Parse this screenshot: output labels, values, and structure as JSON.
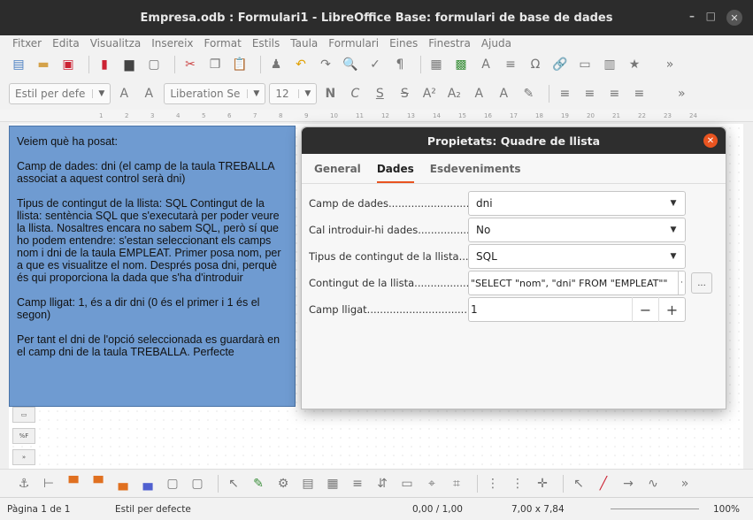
{
  "window": {
    "title": "Empresa.odb : Formulari1 - LibreOffice Base: formulari de base de dades"
  },
  "menu": [
    "Fitxer",
    "Edita",
    "Visualitza",
    "Insereix",
    "Format",
    "Estils",
    "Taula",
    "Formulari",
    "Eines",
    "Finestra",
    "Ajuda"
  ],
  "formatting": {
    "style_value": "Estil per defe",
    "font_value": "Liberation Se",
    "size_value": "12"
  },
  "ruler": [
    "1",
    "2",
    "3",
    "4",
    "5",
    "6",
    "7",
    "8",
    "9",
    "10",
    "11",
    "12",
    "13",
    "14",
    "15",
    "16",
    "17",
    "18",
    "19",
    "20",
    "21",
    "22",
    "23",
    "24"
  ],
  "note": {
    "p1": "Veiem què ha posat:",
    "p2": "Camp de dades: dni (el camp de la taula TREBALLA associat a aquest control serà dni)",
    "p3": "Tipus de contingut de la llista: SQL Contingut de la llista: sentència SQL que s'executarà per poder veure la llista. Nosaltres encara no sabem SQL, però sí que ho podem entendre: s'estan seleccionant els camps nom i dni de la taula EMPLEAT. Primer posa nom, per a que es visualitze el nom. Després posa dni, perquè és qui proporciona la dada que s'ha d'introduir",
    "p4": "Camp lligat: 1, és a dir dni (0 és el primer i 1 és el segon)",
    "p5": "Per tant el dni de l'opció seleccionada es guardarà en el camp dni de la taula TREBALLA. Perfecte"
  },
  "dialog": {
    "title": "Propietats: Quadre de llista",
    "tabs": [
      "General",
      "Dades",
      "Esdeveniments"
    ],
    "active_tab": "Dades",
    "rows": [
      {
        "label": "Camp de dades..........................",
        "value": "dni"
      },
      {
        "label": "Cal introduir-hi dades....................",
        "value": "No"
      },
      {
        "label": "Tipus de contingut de la llista.....",
        "value": "SQL"
      },
      {
        "label": "Contingut de la llista...................",
        "value": "\"SELECT \"nom\", \"dni\" FROM \"EMPLEAT\"\""
      },
      {
        "label": "Camp lligat.......................................",
        "value": "1"
      }
    ],
    "more_label": "...",
    "minus_label": "−",
    "plus_label": "+"
  },
  "status": {
    "page": "Pàgina 1 de 1",
    "style": "Estil per defecte",
    "position": "0,00 / 1,00",
    "size": "7,00 x 7,84",
    "zoom": "100%"
  },
  "colors": {
    "note_bg": "#6f9bd1",
    "accent": "#e95420",
    "titlebar": "#2c2c2c"
  }
}
